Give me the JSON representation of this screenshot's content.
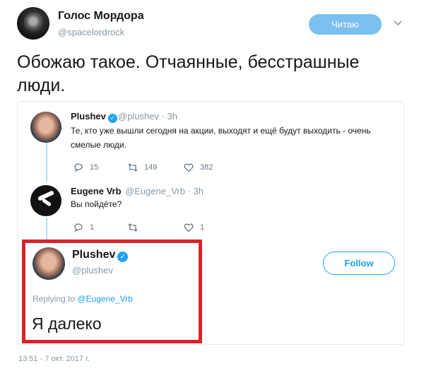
{
  "tweet": {
    "author_name": "Голос Мордора",
    "author_handle": "@spacelordrock",
    "follow_state_label": "Читаю",
    "text": "Обожаю такое. Отчаянные, бесстрашные люди.",
    "timestamp": "13:51 - 7 окт. 2017 г."
  },
  "thread": [
    {
      "name": "Plushev",
      "meta": "@plushev · 3h",
      "text": "Те, кто уже вышли сегодня на акции, выходят и ещё будут выходить - очень смелые люди.",
      "replies": "15",
      "retweets": "149",
      "likes": "382"
    },
    {
      "name": "Eugene Vrb",
      "meta": "@Eugene_Vrb · 3h",
      "text": "Вы пойдёте?",
      "replies": "1",
      "retweets": "",
      "likes": "1"
    }
  ],
  "reply": {
    "name": "Plushev",
    "handle": "@plushev",
    "follow_label": "Follow",
    "replying_to_prefix": "Replying to",
    "replying_to_handle": "@Eugene_Vrb",
    "text": "Я далеко"
  },
  "colors": {
    "accent": "#1da1f2",
    "highlight_border": "#d8232a",
    "follow_state_bg": "#7cc0ef"
  }
}
